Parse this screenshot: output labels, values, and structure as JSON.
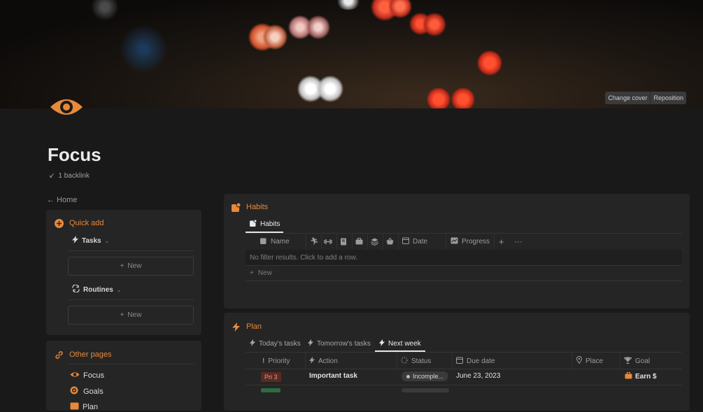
{
  "cover": {
    "change_cover": "Change cover",
    "reposition": "Reposition"
  },
  "page": {
    "title": "Focus",
    "backlink": "1 backlink",
    "home_link": "← Home"
  },
  "colors": {
    "accent": "#e8893a",
    "background": "#191919",
    "card": "#252525",
    "pri3_bg": "#5a2a22",
    "pri3_text": "#e39d8a"
  },
  "quick_add": {
    "title": "Quick add",
    "items": [
      {
        "label": "Tasks",
        "icon": "lightning-icon",
        "new_label": "New"
      },
      {
        "label": "Routines",
        "icon": "repeat-icon",
        "new_label": "New"
      }
    ]
  },
  "other_pages": {
    "title": "Other pages",
    "links": [
      {
        "label": "Focus"
      },
      {
        "label": "Goals"
      },
      {
        "label": "Plan"
      }
    ]
  },
  "habits": {
    "title": "Habits",
    "tab_label": "Habits",
    "columns": {
      "name": "Name",
      "date": "Date",
      "progress": "Progress"
    },
    "empty_text": "No filter results. Click to add a row.",
    "new_label": "New"
  },
  "plan": {
    "title": "Plan",
    "tabs": [
      {
        "label": "Today's tasks"
      },
      {
        "label": "Tomorrow's tasks"
      },
      {
        "label": "Next week"
      }
    ],
    "columns": {
      "priority": "Priority",
      "action": "Action",
      "status": "Status",
      "due_date": "Due date",
      "place": "Place",
      "goal": "Goal"
    },
    "rows": [
      {
        "priority": "Pri 3",
        "action": "Important task",
        "status": "Incomple...",
        "due_date": "June 23, 2023",
        "goal": "Earn $"
      }
    ]
  }
}
